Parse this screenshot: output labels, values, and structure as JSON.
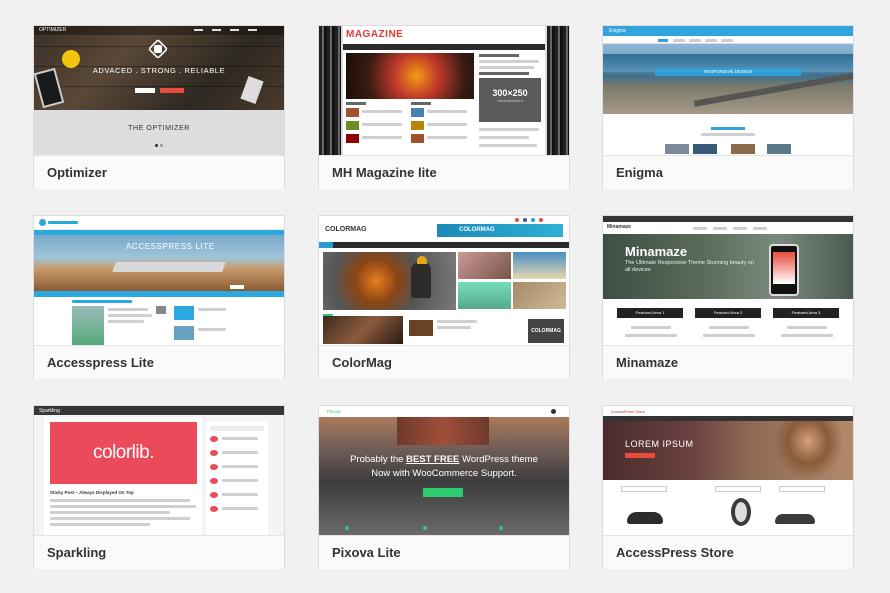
{
  "themes": [
    {
      "name": "Optimizer"
    },
    {
      "name": "MH Magazine lite"
    },
    {
      "name": "Enigma"
    },
    {
      "name": "Accesspress Lite"
    },
    {
      "name": "ColorMag"
    },
    {
      "name": "Minamaze"
    },
    {
      "name": "Sparkling"
    },
    {
      "name": "Pixova Lite"
    },
    {
      "name": "AccessPress Store"
    }
  ],
  "previews": {
    "optimizer": {
      "logo": "OPTIMIZER",
      "tagline": "ADVACED . STRONG . RELIABLE",
      "subtitle": "THE OPTIMIZER"
    },
    "mh": {
      "logo": "MAGAZINE",
      "ad_size": "300×250",
      "ad_label": "Advertisement"
    },
    "enigma": {
      "logo": "Enigma",
      "band": "RESPONSIVE DESIGN"
    },
    "accesspress": {
      "hero": "ACCESSPRESS LITE"
    },
    "colormag": {
      "logo": "COLORMAG",
      "banner": "COLORMAG",
      "badge": "COLORMAG"
    },
    "minamaze": {
      "logo": "Minamaze",
      "title": "Minamaze",
      "subtitle": "The Ultimate Responsive Theme Stunning beauty on all devices",
      "btn1": "Featured Area 1",
      "btn2": "Featured Area 2",
      "btn3": "Featured Area 3"
    },
    "sparkling": {
      "logo": "Sparkling",
      "brand": "colorlib.",
      "post": "Sticky Post – Always Displayed On Top"
    },
    "pixova": {
      "logo": "Pixova",
      "line1_pre": "Probably the ",
      "line1_bold": "BEST FREE",
      "line1_post": " WordPress theme",
      "line2": "Now with WooCommerce Support."
    },
    "store": {
      "logo": "AccessPress Store",
      "hero": "LOREM  IPSUM"
    }
  }
}
